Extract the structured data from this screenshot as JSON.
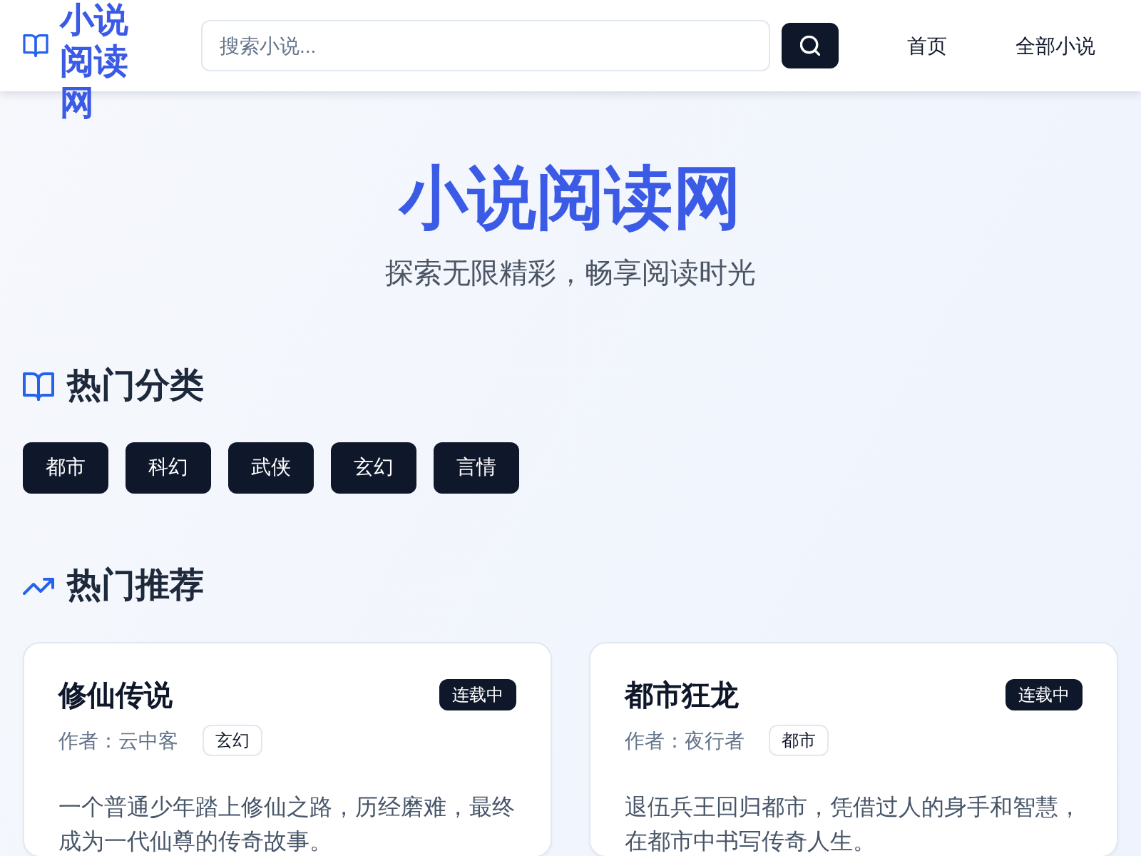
{
  "header": {
    "logo": "小说阅读网",
    "search": {
      "placeholder": "搜索小说..."
    },
    "nav": [
      "首页",
      "全部小说"
    ]
  },
  "hero": {
    "title": "小说阅读网",
    "subtitle": "探索无限精彩，畅享阅读时光"
  },
  "categories_section": {
    "title": "热门分类",
    "categories": [
      "都市",
      "科幻",
      "武侠",
      "玄幻",
      "言情"
    ]
  },
  "recommend_section": {
    "title": "热门推荐",
    "novels": [
      {
        "title": "修仙传说",
        "status": "连载中",
        "author": "作者：云中客",
        "genre": "玄幻",
        "description": "一个普通少年踏上修仙之路，历经磨难，最终成为一代仙尊的传奇故事。"
      },
      {
        "title": "都市狂龙",
        "status": "连载中",
        "author": "作者：夜行者",
        "genre": "都市",
        "description": "退伍兵王回归都市，凭借过人的身手和智慧，在都市中书写传奇人生。"
      }
    ]
  }
}
